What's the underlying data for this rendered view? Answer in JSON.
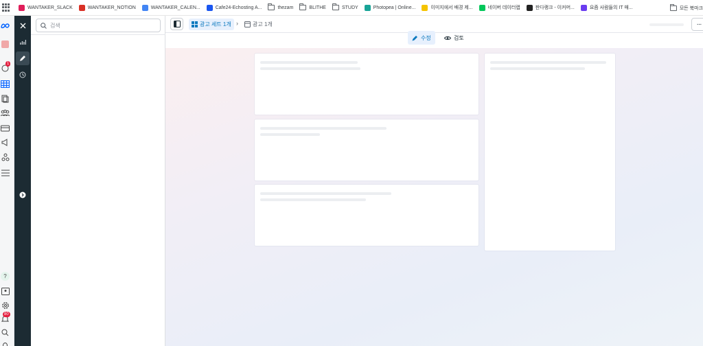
{
  "bookmarks": [
    {
      "label": "WANTAKER_SLACK",
      "icon": "slack-icon",
      "color": "#e01e5a"
    },
    {
      "label": "WANTAKER_NOTION",
      "icon": "calendar-icon",
      "color": "#d93025"
    },
    {
      "label": "WANTAKER_CALEN...",
      "icon": "calendar-icon",
      "color": "#4285f4"
    },
    {
      "label": "Cafe24-Echosting A...",
      "icon": "cafe24-icon",
      "color": "#1a56f0"
    },
    {
      "label": "thezam",
      "icon": "folder-icon"
    },
    {
      "label": "BLITHE",
      "icon": "folder-icon"
    },
    {
      "label": "STUDY",
      "icon": "folder-icon"
    },
    {
      "label": "Photopea | Online...",
      "icon": "photopea-icon",
      "color": "#18a497"
    },
    {
      "label": "이미지에서 배경 제...",
      "icon": "removebg-icon",
      "color": "#f5c400"
    },
    {
      "label": "네이버 데이터랩",
      "icon": "naver-icon",
      "color": "#03c75a"
    },
    {
      "label": "판다랭크 - 이커머...",
      "icon": "pandarank-icon",
      "color": "#222222"
    },
    {
      "label": "요즘 사람들의 IT 매...",
      "icon": "yozm-icon",
      "color": "#6a3cf0"
    }
  ],
  "bookmarks_right": "모든 북마크",
  "notifications": {
    "badge_top": "1",
    "badge_bottom": "80"
  },
  "search": {
    "placeholder": "검색"
  },
  "breadcrumb": {
    "active": "광고 세트 1개",
    "second": "광고 1개"
  },
  "modes": {
    "edit": "수정",
    "review": "검토"
  },
  "colors": {
    "accent": "#0a78be",
    "dark_rail": "#1c2b33",
    "badge": "#e41e3f"
  }
}
